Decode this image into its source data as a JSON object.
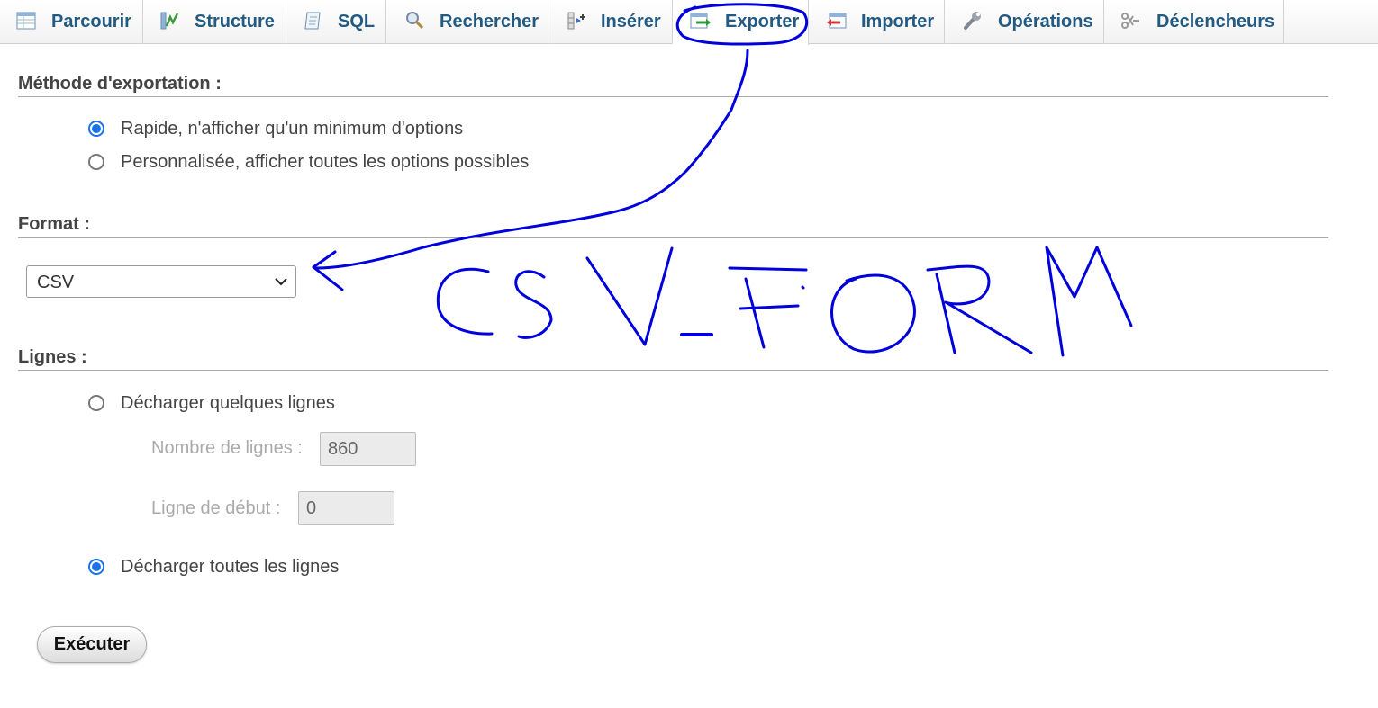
{
  "tabs": [
    {
      "label": "Parcourir",
      "icon": "browse-table-icon"
    },
    {
      "label": "Structure",
      "icon": "structure-icon"
    },
    {
      "label": "SQL",
      "icon": "sql-icon"
    },
    {
      "label": "Rechercher",
      "icon": "magnifier-icon"
    },
    {
      "label": "Insérer",
      "icon": "insert-icon"
    },
    {
      "label": "Exporter",
      "icon": "export-icon",
      "active": true
    },
    {
      "label": "Importer",
      "icon": "import-icon"
    },
    {
      "label": "Opérations",
      "icon": "wrench-icon"
    },
    {
      "label": "Déclencheurs",
      "icon": "triggers-icon"
    }
  ],
  "export_method": {
    "heading": "Méthode d'exportation :",
    "options": [
      {
        "label": "Rapide, n'afficher qu'un minimum d'options",
        "checked": true
      },
      {
        "label": "Personnalisée, afficher toutes les options possibles",
        "checked": false
      }
    ]
  },
  "format": {
    "heading": "Format :",
    "selected": "CSV"
  },
  "rows": {
    "heading": "Lignes :",
    "dump_some_label": "Décharger quelques lignes",
    "dump_some_checked": false,
    "num_rows_label": "Nombre de lignes :",
    "num_rows_value": "860",
    "start_row_label": "Ligne de début :",
    "start_row_value": "0",
    "dump_all_label": "Décharger toutes les lignes",
    "dump_all_checked": true
  },
  "execute_label": "Exécuter",
  "annotation": {
    "text": "CSV-FORM",
    "color": "#0000dd"
  },
  "colors": {
    "tab_text": "#235a81",
    "radio_accent": "#1a73e8"
  }
}
